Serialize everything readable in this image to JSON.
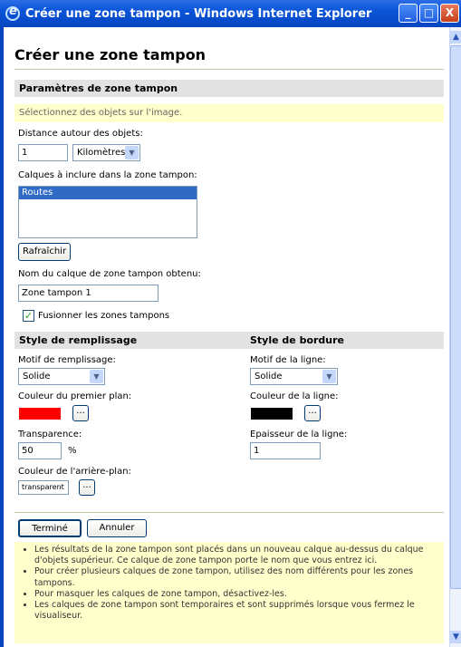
{
  "window": {
    "title": "Créer une zone tampon - Windows Internet Explorer",
    "controls": {
      "minimize": "_",
      "maximize": "□",
      "close": "X"
    }
  },
  "page": {
    "title": "Créer une zone tampon",
    "params_section": "Paramètres de zone tampon",
    "hint": "Sélectionnez des objets sur l'image.",
    "distance": {
      "label": "Distance autour des objets:",
      "value": "1",
      "unit": "Kilomètres"
    },
    "layers": {
      "label": "Calques à inclure dans la zone tampon:",
      "items": [
        "Routes"
      ]
    },
    "refresh_button": "Rafraîchir",
    "result_name": {
      "label": "Nom du calque de zone tampon obtenu:",
      "value": "Zone tampon 1"
    },
    "merge": {
      "label": "Fusionner les zones tampons",
      "checked": true
    },
    "fill": {
      "section": "Style de remplissage",
      "pattern_label": "Motif de remplissage:",
      "pattern_value": "Solide",
      "fg_color_label": "Couleur du premier plan:",
      "fg_color": "#ff0000",
      "transparency_label": "Transparence:",
      "transparency_value": "50",
      "transparency_unit": "%",
      "bg_color_label": "Couleur de l'arrière-plan:",
      "bg_color_value": "transparent"
    },
    "border": {
      "section": "Style de bordure",
      "pattern_label": "Motif de la ligne:",
      "pattern_value": "Solide",
      "color_label": "Couleur de la ligne:",
      "color": "#000000",
      "thickness_label": "Epaisseur de la ligne:",
      "thickness_value": "1"
    },
    "ellipsis": "...",
    "done_button": "Terminé",
    "cancel_button": "Annuler",
    "help": [
      "Les résultats de la zone tampon sont placés dans un nouveau calque au-dessus du calque d'objets supérieur. Ce calque de zone tampon porte le nom que vous entrez ici.",
      "Pour créer plusieurs calques de zone tampon, utilisez des nom différents pour les zones tampons.",
      "Pour masquer les calques de zone tampon, désactivez-les.",
      "Les calques de zone tampon sont temporaires et sont supprimés lorsque vous fermez le visualiseur."
    ]
  }
}
